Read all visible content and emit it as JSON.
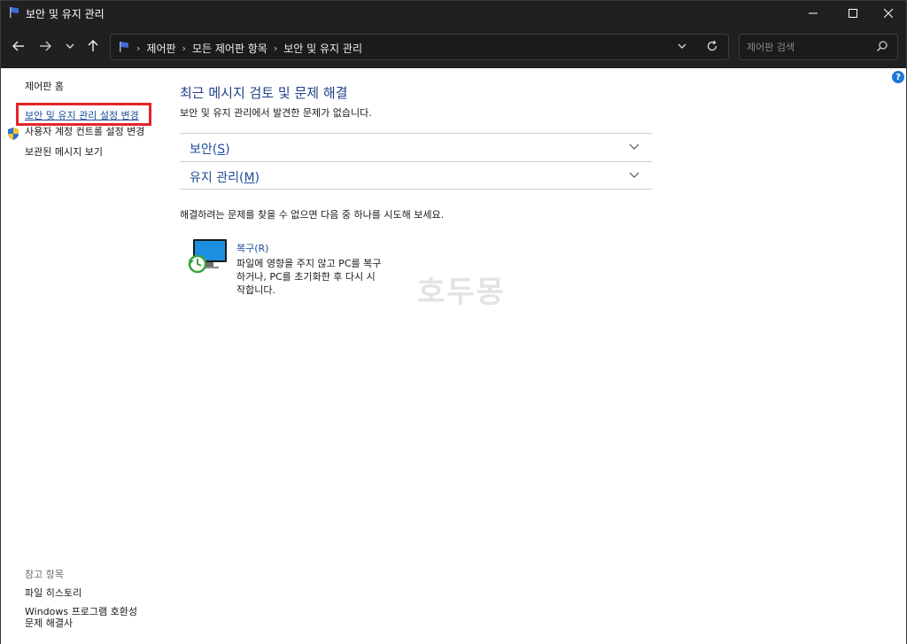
{
  "window": {
    "title": "보안 및 유지 관리"
  },
  "address": {
    "crumbs": [
      "제어판",
      "모든 제어판 항목",
      "보안 및 유지 관리"
    ]
  },
  "search": {
    "placeholder": "제어판 검색"
  },
  "left_nav": {
    "home": "제어판 홈",
    "items": [
      "보안 및 유지 관리 설정 변경",
      "사용자 계정 컨트롤 설정 변경",
      "보관된 메시지 보기"
    ],
    "see_also_header": "참고 항목",
    "see_also": [
      "파일 히스토리",
      "Windows 프로그램 호환성",
      "문제 해결사"
    ]
  },
  "main": {
    "heading": "최근 메시지 검토 및 문제 해결",
    "subtext": "보안 및 유지 관리에서 발견한 문제가 없습니다.",
    "sections": [
      {
        "label": "보안(",
        "accel": "S",
        "end": ")"
      },
      {
        "label": "유지 관리(",
        "accel": "M",
        "end": ")"
      }
    ],
    "try_text": "해결하려는 문제를 찾을 수 없으면 다음 중 하나를 시도해 보세요.",
    "recovery": {
      "title": "복구(R)",
      "desc_lines": [
        "파일에 영향을 주지 않고 PC를 복구",
        "하거나, PC를 초기화한 후 다시 시",
        "작합니다."
      ]
    }
  },
  "watermark": "호두몽",
  "colors": {
    "accent": "#1f4d9a",
    "highlight": "#e4252c",
    "titlebar": "#202020"
  }
}
